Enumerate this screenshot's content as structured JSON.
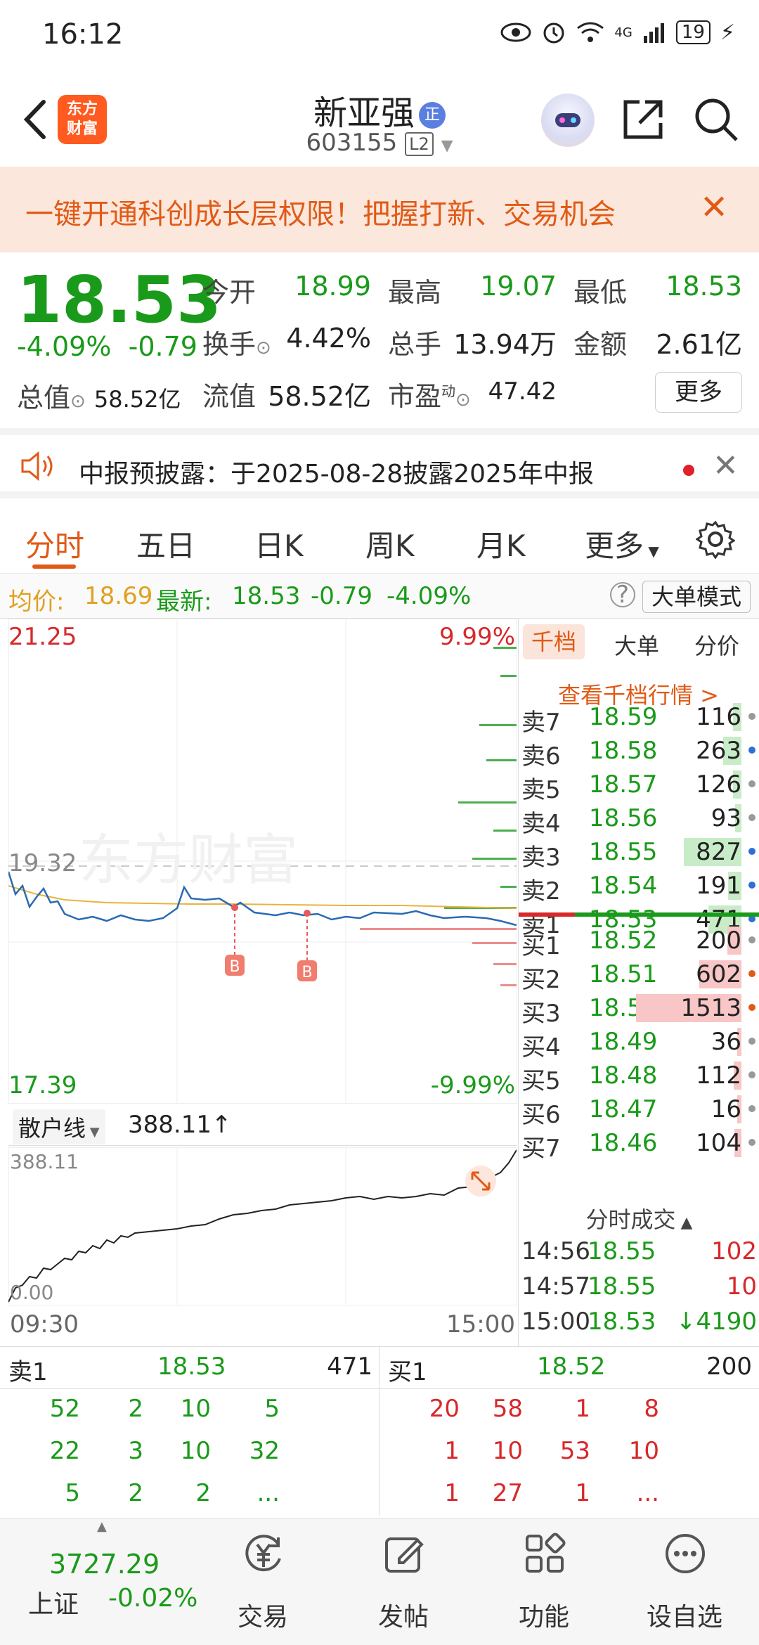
{
  "status_bar": {
    "time": "16:12",
    "battery": "19",
    "network": "4G"
  },
  "header": {
    "logo_line1": "东方",
    "logo_line2": "财富",
    "stock_name": "新亚强",
    "name_badge": "正",
    "stock_code": "603155",
    "level_badge": "L2"
  },
  "banner": {
    "text": "一键开通科创成长层权限！把握打新、交易机会"
  },
  "quote": {
    "price": "18.53",
    "change_pct": "-4.09%",
    "change": "-0.79",
    "open_label": "今开",
    "open": "18.99",
    "high_label": "最高",
    "high": "19.07",
    "low_label": "最低",
    "low": "18.53",
    "turnover_label": "换手",
    "turnover": "4.42%",
    "volume_label": "总手",
    "volume": "13.94万",
    "amount_label": "金额",
    "amount": "2.61亿",
    "total_mv_label": "总值",
    "total_mv": "58.52亿",
    "float_mv_label": "流值",
    "float_mv": "58.52亿",
    "pe_label": "市盈",
    "pe_sup": "动",
    "pe": "47.42",
    "more_label": "更多"
  },
  "notice": {
    "text": "中报预披露：于2025-08-28披露2025年中报"
  },
  "tabs": [
    "分时",
    "五日",
    "日K",
    "周K",
    "月K",
    "更多"
  ],
  "infoline": {
    "avg_label": "均价:",
    "avg": "18.69",
    "latest_label": "最新:",
    "latest": "18.53",
    "change": "-0.79",
    "change_pct": "-4.09%",
    "mode_button": "大单模式"
  },
  "chart": {
    "y_top": "21.25",
    "y_mid": "19.32",
    "y_bottom": "17.39",
    "pct_top": "9.99%",
    "pct_bottom": "-9.99%",
    "watermark": "东方财富",
    "marker_label": "B",
    "sub_indicator": "散户线",
    "sub_value": "388.11↑",
    "sub_top": "388.11",
    "sub_bottom": "0.00",
    "time_start": "09:30",
    "time_end": "15:00"
  },
  "book": {
    "tabs": [
      "千档",
      "大单",
      "分价"
    ],
    "link": "查看千档行情 >",
    "asks": [
      {
        "label": "卖7",
        "price": "18.59",
        "vol": "116",
        "dot": "#999999"
      },
      {
        "label": "卖6",
        "price": "18.58",
        "vol": "263",
        "dot": "#2f6fd6"
      },
      {
        "label": "卖5",
        "price": "18.57",
        "vol": "126",
        "dot": "#999999"
      },
      {
        "label": "卖4",
        "price": "18.56",
        "vol": "93",
        "dot": "#999999"
      },
      {
        "label": "卖3",
        "price": "18.55",
        "vol": "827",
        "dot": "#2f6fd6"
      },
      {
        "label": "卖2",
        "price": "18.54",
        "vol": "191",
        "dot": "#2f6fd6"
      },
      {
        "label": "卖1",
        "price": "18.53",
        "vol": "471",
        "dot": "#2f6fd6"
      }
    ],
    "bids": [
      {
        "label": "买1",
        "price": "18.52",
        "vol": "200",
        "dot": "#999999"
      },
      {
        "label": "买2",
        "price": "18.51",
        "vol": "602",
        "dot": "#e05a16"
      },
      {
        "label": "买3",
        "price": "18.50",
        "vol": "1513",
        "dot": "#e05a16"
      },
      {
        "label": "买4",
        "price": "18.49",
        "vol": "36",
        "dot": "#999999"
      },
      {
        "label": "买5",
        "price": "18.48",
        "vol": "112",
        "dot": "#999999"
      },
      {
        "label": "买6",
        "price": "18.47",
        "vol": "16",
        "dot": "#999999"
      },
      {
        "label": "买7",
        "price": "18.46",
        "vol": "104",
        "dot": "#999999"
      }
    ],
    "trades_header": "分时成交",
    "trades": [
      {
        "time": "14:56",
        "price": "18.55",
        "vol": "102",
        "dir": ""
      },
      {
        "time": "14:57",
        "price": "18.55",
        "vol": "10",
        "dir": ""
      },
      {
        "time": "15:00",
        "price": "18.53",
        "vol": "4190",
        "dir": "↓"
      }
    ]
  },
  "queue": {
    "sell": {
      "label": "卖1",
      "price": "18.53",
      "vol": "471",
      "rows": [
        [
          "52",
          "2",
          "10",
          "5"
        ],
        [
          "22",
          "3",
          "10",
          "32"
        ],
        [
          "5",
          "2",
          "2",
          "..."
        ]
      ]
    },
    "buy": {
      "label": "买1",
      "price": "18.52",
      "vol": "200",
      "rows": [
        [
          "20",
          "58",
          "1",
          "8"
        ],
        [
          "1",
          "10",
          "53",
          "10"
        ],
        [
          "1",
          "27",
          "1",
          "..."
        ]
      ]
    }
  },
  "nav": {
    "index_value": "3727.29",
    "index_name": "上证",
    "index_change": "-0.02%",
    "items": [
      "交易",
      "发帖",
      "功能",
      "设自选"
    ]
  }
}
